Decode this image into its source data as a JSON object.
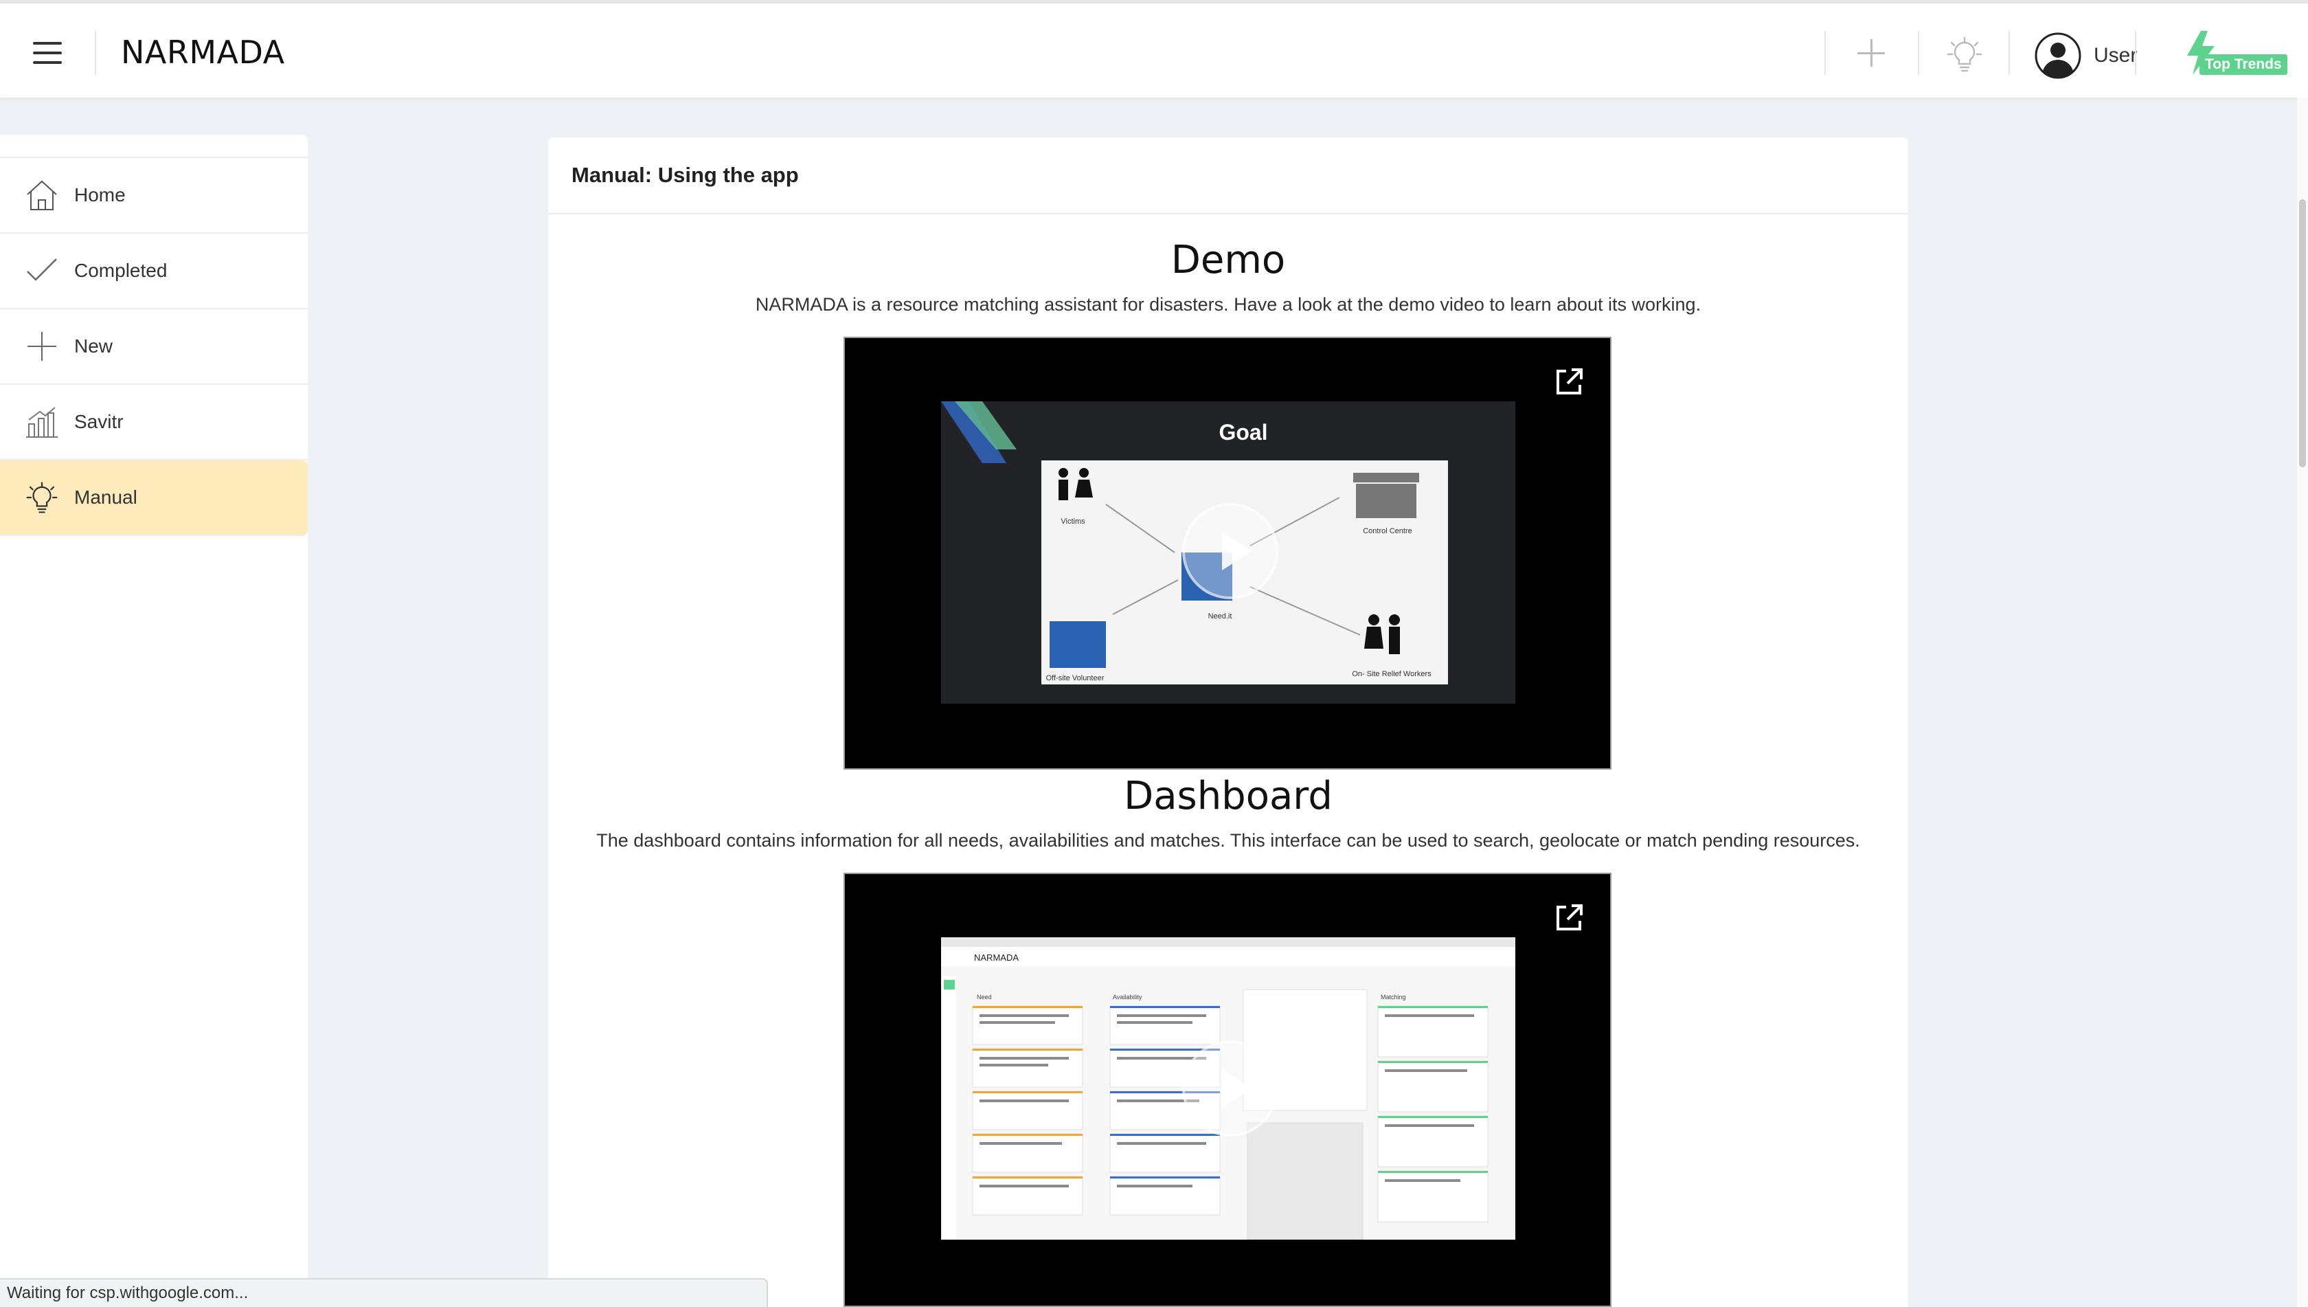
{
  "header": {
    "app_title": "NARMADA",
    "user_label": "User",
    "top_trends_label": "Top Trends",
    "accent": "#5ed38d"
  },
  "sidebar": {
    "items": [
      {
        "label": "Home",
        "icon": "home-icon"
      },
      {
        "label": "Completed",
        "icon": "check-icon"
      },
      {
        "label": "New",
        "icon": "plus-icon"
      },
      {
        "label": "Savitr",
        "icon": "chart-icon"
      },
      {
        "label": "Manual",
        "icon": "bulb-icon",
        "active": true
      }
    ],
    "active_color": "#fdebbc"
  },
  "main": {
    "card_title": "Manual: Using the app",
    "sections": [
      {
        "title": "Demo",
        "description": "NARMADA is a resource matching assistant for disasters. Have a look at the demo video to learn about its working.",
        "video": {
          "slide_title": "Goal",
          "labels": [
            "Victims",
            "Control Centre",
            "Need.it",
            "Off-site Volunteer",
            "On- Site Relief Workers"
          ]
        }
      },
      {
        "title": "Dashboard",
        "description": "The dashboard contains information for all needs, availabilities and matches. This interface can be used to search, geolocate or match pending resources.",
        "video": {
          "app_name": "NARMADA",
          "columns": [
            "Need",
            "Availability",
            "Matching"
          ]
        }
      }
    ]
  },
  "status_bar": {
    "text": "Waiting for csp.withgoogle.com..."
  }
}
